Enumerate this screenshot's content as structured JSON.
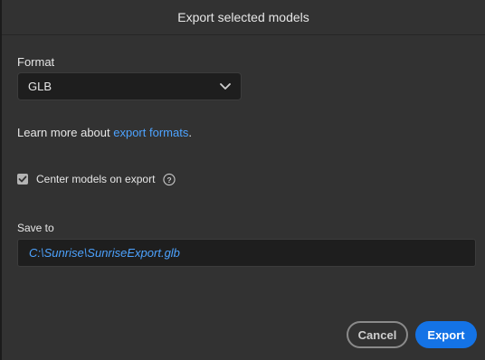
{
  "dialog": {
    "title": "Export selected models"
  },
  "format": {
    "label": "Format",
    "selected": "GLB",
    "chevron_icon": "chevron-down-icon"
  },
  "learn_more": {
    "prefix": "Learn more about ",
    "link_text": "export formats",
    "suffix": "."
  },
  "center_models": {
    "label": "Center models on export",
    "checked": true,
    "help_icon": "question-circle-icon"
  },
  "save_to": {
    "label": "Save to",
    "path": "C:\\Sunrise\\SunriseExport.glb"
  },
  "buttons": {
    "cancel": "Cancel",
    "export": "Export"
  },
  "colors": {
    "accent": "#1473e6",
    "link": "#4da3ff",
    "panel": "#323232",
    "field": "#1e1e1e"
  }
}
